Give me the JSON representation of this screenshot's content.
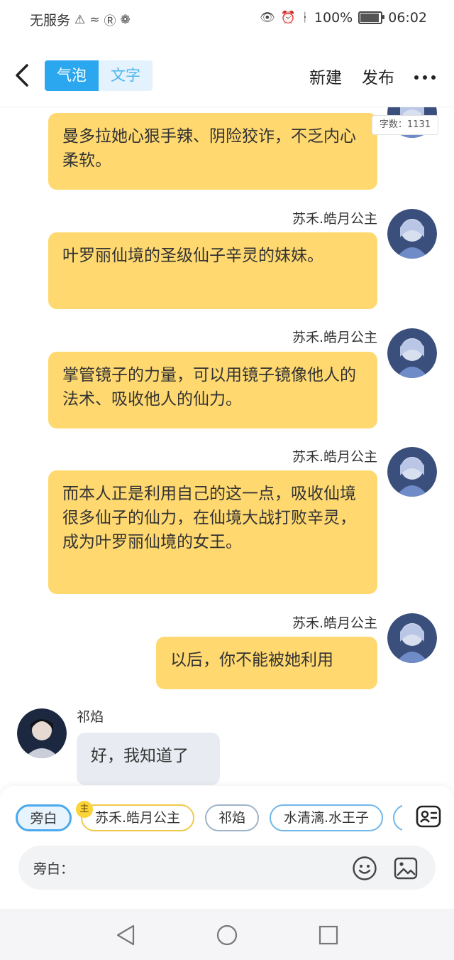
{
  "status_bar": {
    "carrier": "无服务",
    "battery": "100%",
    "battery_level": 1.0,
    "time": "06:02"
  },
  "header": {
    "tab_bubble": "气泡",
    "tab_text": "文字",
    "new_label": "新建",
    "publish_label": "发布"
  },
  "word_count": "字数：1131",
  "messages": [
    {
      "sender": "",
      "text": "曼多拉她心狠手辣、阴险狡诈，不乏内心柔软。",
      "side": "right"
    },
    {
      "sender": "苏禾.皓月公主",
      "text": "叶罗丽仙境的圣级仙子辛灵的妹妹。",
      "side": "right"
    },
    {
      "sender": "苏禾.皓月公主",
      "text": "掌管镜子的力量，可以用镜子镜像他人的法术、吸收他人的仙力。",
      "side": "right"
    },
    {
      "sender": "苏禾.皓月公主",
      "text": "而本人正是利用自己的这一点，吸收仙境很多仙子的仙力，在仙境大战打败辛灵，成为叶罗丽仙境的女王。",
      "side": "right"
    },
    {
      "sender": "苏禾.皓月公主",
      "text": "以后，你不能被她利用",
      "side": "right"
    },
    {
      "sender": "祁焰",
      "text": "好，我知道了",
      "side": "left"
    }
  ],
  "roles": [
    {
      "label": "旁白"
    },
    {
      "label": "苏禾.皓月公主",
      "badge": "主"
    },
    {
      "label": "祁焰"
    },
    {
      "label": "水清漓.水王子"
    }
  ],
  "input": {
    "label": "旁白：",
    "placeholder": ""
  },
  "colors": {
    "accent": "#2aa7ef",
    "my_bubble": "#ffd970",
    "other_bubble": "#e8ecf2"
  }
}
